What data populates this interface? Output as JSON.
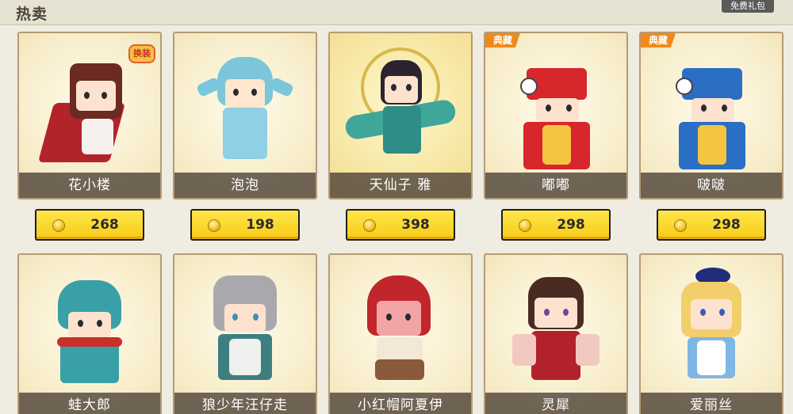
{
  "header": {
    "title": "热卖",
    "gift_label": "免费礼包"
  },
  "badges": {
    "classic": "典藏",
    "swap": "换装"
  },
  "row1": [
    {
      "name": "花小楼",
      "price": "268",
      "badge": "",
      "swap": true
    },
    {
      "name": "泡泡",
      "price": "198",
      "badge": "",
      "swap": false
    },
    {
      "name": "天仙子 雅",
      "price": "398",
      "badge": "",
      "swap": false
    },
    {
      "name": "嘟嘟",
      "price": "298",
      "badge": "典藏",
      "swap": false
    },
    {
      "name": "啵啵",
      "price": "298",
      "badge": "典藏",
      "swap": false
    }
  ],
  "row2": [
    {
      "name": "蛙大郎"
    },
    {
      "name": "狼少年汪仔走"
    },
    {
      "name": "小红帽阿夏伊"
    },
    {
      "name": "灵犀"
    },
    {
      "name": "爱丽丝"
    }
  ],
  "icons": {
    "currency": "coin-icon"
  }
}
